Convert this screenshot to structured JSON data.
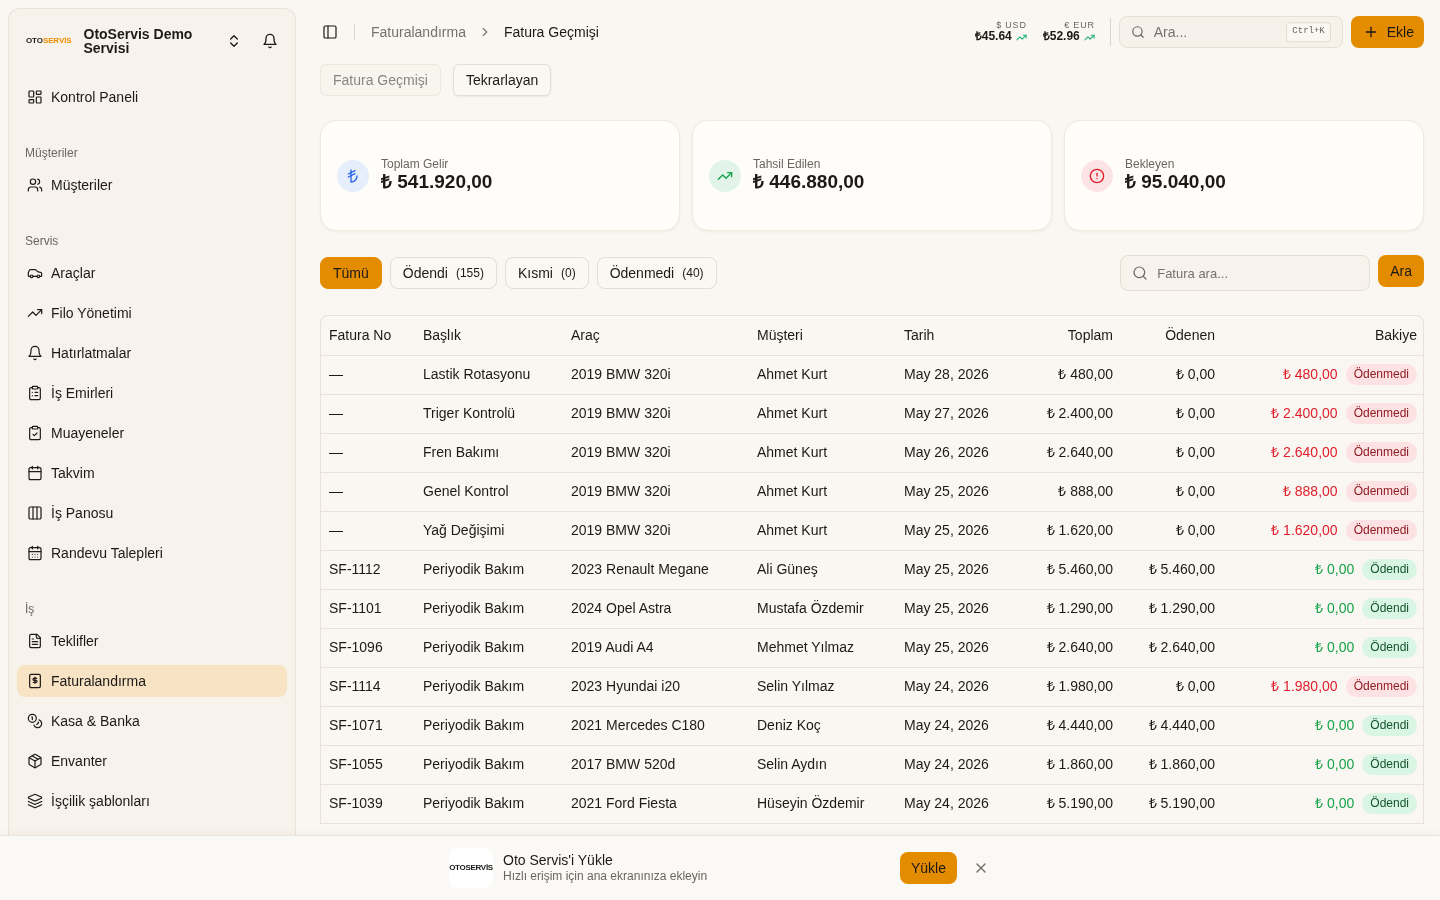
{
  "sidebar": {
    "brand": {
      "logo_text": [
        "OTO",
        "SERVİS"
      ],
      "name": "OtoServis Demo Servisi",
      "expanded": false
    },
    "groups": [
      {
        "items": [
          {
            "label": "Kontrol Paneli",
            "selected": false
          }
        ]
      },
      {
        "heading": "Müşteriler",
        "items": [
          {
            "label": "Müşteriler",
            "selected": false
          }
        ]
      },
      {
        "heading": "Servis",
        "items": [
          {
            "label": "Araçlar",
            "selected": false
          },
          {
            "label": "Filo Yönetimi",
            "selected": false
          },
          {
            "label": "Hatırlatmalar",
            "selected": false
          },
          {
            "label": "İş Emirleri",
            "selected": false
          },
          {
            "label": "Muayeneler",
            "selected": false
          },
          {
            "label": "Takvim",
            "selected": false
          },
          {
            "label": "İş Panosu",
            "selected": false
          },
          {
            "label": "Randevu Talepleri",
            "selected": false
          }
        ]
      },
      {
        "heading": "İş",
        "items": [
          {
            "label": "Teklifler",
            "selected": false
          },
          {
            "label": "Faturalandırma",
            "selected": true
          },
          {
            "label": "Kasa & Banka",
            "selected": false
          },
          {
            "label": "Envanter",
            "selected": false
          },
          {
            "label": "İşçilik şablonları",
            "selected": false
          }
        ]
      }
    ]
  },
  "topbar": {
    "breadcrumb": [
      "Faturalandırma",
      "Fatura Geçmişi"
    ],
    "rates": [
      {
        "label": "$ USD",
        "value": "₺45.64"
      },
      {
        "label": "€ EUR",
        "value": "₺52.96"
      }
    ],
    "search": {
      "placeholder": "Ara...",
      "shortcut": "Ctrl+K"
    },
    "add_button": "Ekle"
  },
  "tabs": [
    {
      "label": "Fatura Geçmişi",
      "selected": true
    },
    {
      "label": "Tekrarlayan",
      "selected": false
    }
  ],
  "stats": [
    {
      "kind": "revenue",
      "label": "Toplam Gelir",
      "value": "₺ 541.920,00"
    },
    {
      "kind": "collected",
      "label": "Tahsil Edilen",
      "value": "₺ 446.880,00"
    },
    {
      "kind": "pending",
      "label": "Bekleyen",
      "value": "₺ 95.040,00"
    }
  ],
  "filters": [
    {
      "label": "Tümü",
      "selected": true
    },
    {
      "label": "Ödendi",
      "count": "(155)",
      "selected": false
    },
    {
      "label": "Kısmi",
      "count": "(0)",
      "selected": false
    },
    {
      "label": "Ödenmedi",
      "count": "(40)",
      "selected": false
    }
  ],
  "invoice_search": {
    "placeholder": "Fatura ara...",
    "button": "Ara"
  },
  "table": {
    "columns": [
      "Fatura No",
      "Başlık",
      "Araç",
      "Müşteri",
      "Tarih",
      "Toplam",
      "Ödenen",
      "Bakiye"
    ],
    "rows": [
      {
        "number": "—",
        "title": "Lastik Rotasyonu",
        "vehicle": "2019 BMW 320i",
        "customer": "Ahmet Kurt",
        "date": "May 28, 2026",
        "total": "₺ 480,00",
        "paid": "₺ 0,00",
        "balance": "₺ 480,00",
        "status": {
          "label": "Ödenmedi",
          "kind": "unpaid"
        }
      },
      {
        "number": "—",
        "title": "Triger Kontrolü",
        "vehicle": "2019 BMW 320i",
        "customer": "Ahmet Kurt",
        "date": "May 27, 2026",
        "total": "₺ 2.400,00",
        "paid": "₺ 0,00",
        "balance": "₺ 2.400,00",
        "status": {
          "label": "Ödenmedi",
          "kind": "unpaid"
        }
      },
      {
        "number": "—",
        "title": "Fren Bakımı",
        "vehicle": "2019 BMW 320i",
        "customer": "Ahmet Kurt",
        "date": "May 26, 2026",
        "total": "₺ 2.640,00",
        "paid": "₺ 0,00",
        "balance": "₺ 2.640,00",
        "status": {
          "label": "Ödenmedi",
          "kind": "unpaid"
        }
      },
      {
        "number": "—",
        "title": "Genel Kontrol",
        "vehicle": "2019 BMW 320i",
        "customer": "Ahmet Kurt",
        "date": "May 25, 2026",
        "total": "₺ 888,00",
        "paid": "₺ 0,00",
        "balance": "₺ 888,00",
        "status": {
          "label": "Ödenmedi",
          "kind": "unpaid"
        }
      },
      {
        "number": "—",
        "title": "Yağ Değişimi",
        "vehicle": "2019 BMW 320i",
        "customer": "Ahmet Kurt",
        "date": "May 25, 2026",
        "total": "₺ 1.620,00",
        "paid": "₺ 0,00",
        "balance": "₺ 1.620,00",
        "status": {
          "label": "Ödenmedi",
          "kind": "unpaid"
        }
      },
      {
        "number": "SF-1112",
        "title": "Periyodik Bakım",
        "vehicle": "2023 Renault Megane",
        "customer": "Ali Güneş",
        "date": "May 25, 2026",
        "total": "₺ 5.460,00",
        "paid": "₺ 5.460,00",
        "balance": "₺ 0,00",
        "status": {
          "label": "Ödendi",
          "kind": "paid"
        }
      },
      {
        "number": "SF-1101",
        "title": "Periyodik Bakım",
        "vehicle": "2024 Opel Astra",
        "customer": "Mustafa Özdemir",
        "date": "May 25, 2026",
        "total": "₺ 1.290,00",
        "paid": "₺ 1.290,00",
        "balance": "₺ 0,00",
        "status": {
          "label": "Ödendi",
          "kind": "paid"
        }
      },
      {
        "number": "SF-1096",
        "title": "Periyodik Bakım",
        "vehicle": "2019 Audi A4",
        "customer": "Mehmet Yılmaz",
        "date": "May 25, 2026",
        "total": "₺ 2.640,00",
        "paid": "₺ 2.640,00",
        "balance": "₺ 0,00",
        "status": {
          "label": "Ödendi",
          "kind": "paid"
        }
      },
      {
        "number": "SF-1114",
        "title": "Periyodik Bakım",
        "vehicle": "2023 Hyundai i20",
        "customer": "Selin Yılmaz",
        "date": "May 24, 2026",
        "total": "₺ 1.980,00",
        "paid": "₺ 0,00",
        "balance": "₺ 1.980,00",
        "status": {
          "label": "Ödenmedi",
          "kind": "unpaid"
        }
      },
      {
        "number": "SF-1071",
        "title": "Periyodik Bakım",
        "vehicle": "2021 Mercedes C180",
        "customer": "Deniz Koç",
        "date": "May 24, 2026",
        "total": "₺ 4.440,00",
        "paid": "₺ 4.440,00",
        "balance": "₺ 0,00",
        "status": {
          "label": "Ödendi",
          "kind": "paid"
        }
      },
      {
        "number": "SF-1055",
        "title": "Periyodik Bakım",
        "vehicle": "2017 BMW 520d",
        "customer": "Selin Aydın",
        "date": "May 24, 2026",
        "total": "₺ 1.860,00",
        "paid": "₺ 1.860,00",
        "balance": "₺ 0,00",
        "status": {
          "label": "Ödendi",
          "kind": "paid"
        }
      },
      {
        "number": "SF-1039",
        "title": "Periyodik Bakım",
        "vehicle": "2021 Ford Fiesta",
        "customer": "Hüseyin Özdemir",
        "date": "May 24, 2026",
        "total": "₺ 5.190,00",
        "paid": "₺ 5.190,00",
        "balance": "₺ 0,00",
        "status": {
          "label": "Ödendi",
          "kind": "paid"
        }
      }
    ]
  },
  "install_banner": {
    "logo_text": [
      "OTO",
      "SERVİS"
    ],
    "title": "Oto Servis'i Yükle",
    "subtitle": "Hızlı erişim için ana ekranınıza ekleyin",
    "button": "Yükle"
  }
}
